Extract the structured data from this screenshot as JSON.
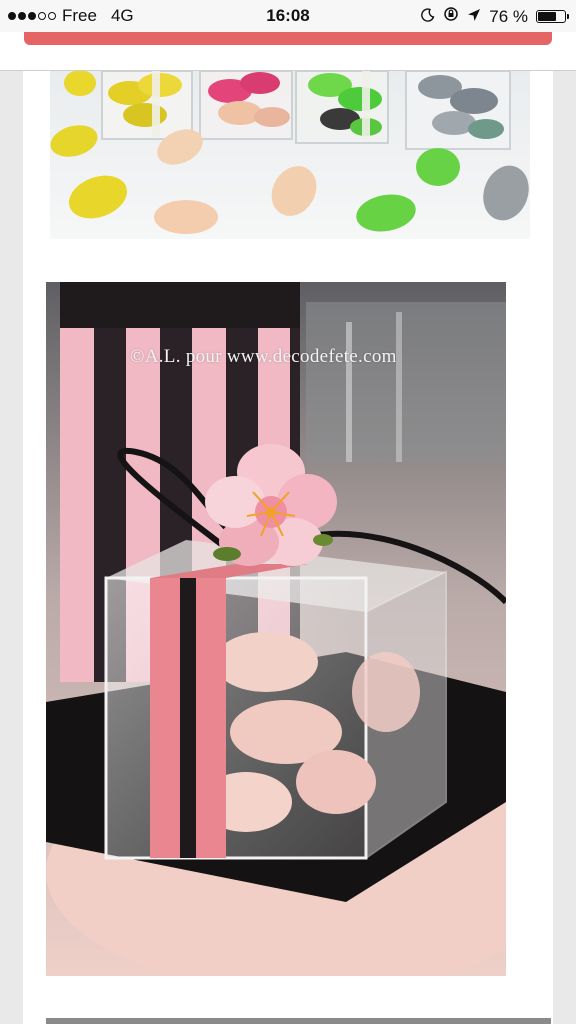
{
  "status_bar": {
    "carrier": "Free",
    "network": "4G",
    "time": "16:08",
    "battery_percent_label": "76 %",
    "battery_level": 0.76,
    "signal_bars_filled": 3,
    "signal_bars_total": 5,
    "icons": [
      "signal-dots-icon",
      "moon-icon",
      "rotation-lock-icon",
      "location-arrow-icon",
      "battery-icon"
    ]
  },
  "header": {
    "accent_color": "#e56567"
  },
  "gallery": {
    "photo1": {
      "subject": "dragees-in-clear-boxes",
      "colors": [
        "#e8d72a",
        "#f0c9a8",
        "#6fd84a",
        "#9aa0a6",
        "#e0457a"
      ]
    },
    "photo2": {
      "subject": "clear-favor-box-with-pink-ribbon-and-flower",
      "watermark": "©A.L. pour www.decodefete.com",
      "colors": [
        "#e9868f",
        "#1e1a1c",
        "#f2c9c2"
      ]
    }
  }
}
